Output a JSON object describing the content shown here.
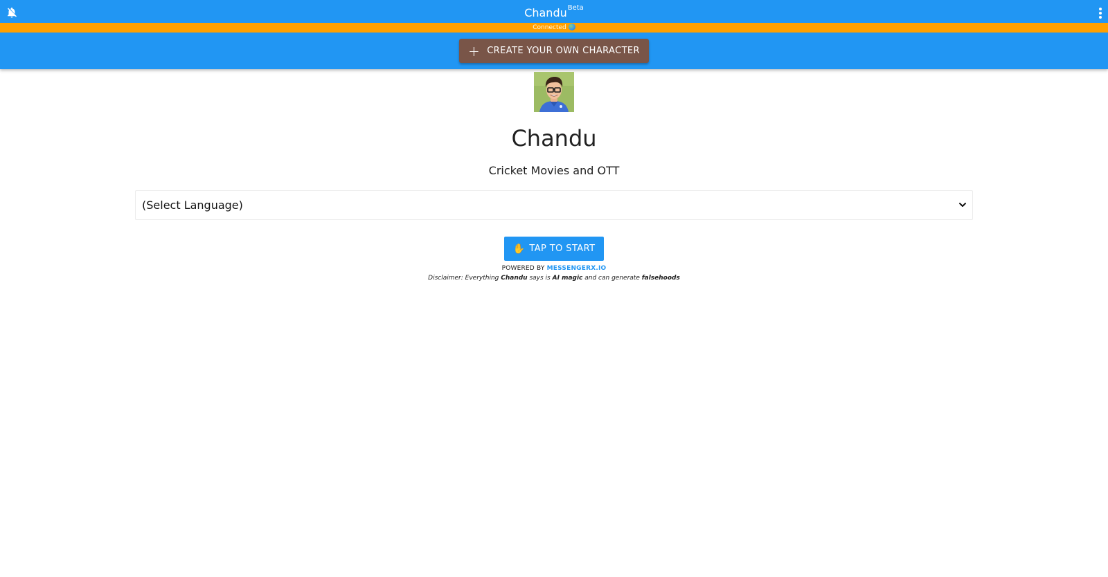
{
  "app_bar": {
    "title": "Chandu",
    "title_badge": "Beta",
    "notifications_icon": "bell-off-icon",
    "menu_icon": "more-vertical-icon",
    "color": "#2196f3"
  },
  "status": {
    "text": "Connected",
    "indicator_icon": "globe-icon",
    "color": "#ffa000"
  },
  "create_button": {
    "icon": "plus-icon",
    "label": "CREATE YOUR OWN CHARACTER",
    "color": "#795548"
  },
  "character": {
    "avatar_icon": "character-avatar",
    "name": "Chandu",
    "description": "Cricket Movies and OTT"
  },
  "language_select": {
    "value": "(Select Language)",
    "icon": "chevron-down-icon"
  },
  "start_button": {
    "icon": "raised-hand-icon",
    "label": "TAP TO START"
  },
  "footer": {
    "powered_prefix": "POWERED BY",
    "powered_link": "MESSENGERX.IO",
    "disclaimer": {
      "part1": "Disclaimer: Everything",
      "name": "Chandu",
      "part2": "says is",
      "emphasis1": "AI magic",
      "part3": "and can generate",
      "emphasis2": "falsehoods"
    }
  }
}
